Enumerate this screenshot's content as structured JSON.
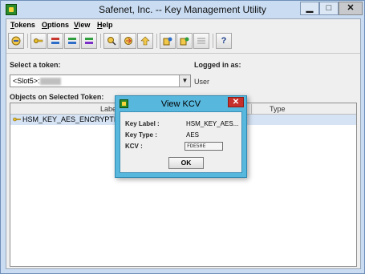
{
  "window": {
    "title": "Safenet, Inc. -- Key Management Utility"
  },
  "window_controls": {
    "minimize": "▁",
    "maximize": "□",
    "close": "✕"
  },
  "menu": [
    "Tokens",
    "Options",
    "View",
    "Help"
  ],
  "toolbar": {
    "buttons": [
      "login-icon",
      "key-icon",
      "key-pair-icon",
      "key-generate-icon",
      "key-list-icon",
      "search-key-icon",
      "wrap-key-icon",
      "upload-icon",
      "token-info-icon",
      "token-info-2-icon",
      "disabled-icon",
      "help-icon"
    ],
    "help_glyph": "?"
  },
  "select_token": {
    "label": "Select a token:",
    "value": "<Slot5>:",
    "arrow": "▼"
  },
  "logged_in": {
    "label": "Logged in as:",
    "value": "User"
  },
  "objects": {
    "label": "Objects on Selected Token:",
    "columns": [
      "Label",
      "Type"
    ],
    "rows": [
      {
        "label": "HSM_KEY_AES_ENCRYPTIO"
      }
    ]
  },
  "dialog": {
    "title": "View KCV",
    "close": "✕",
    "key_label_label": "Key Label :",
    "key_label_value": "HSM_KEY_AES...",
    "key_type_label": "Key Type :",
    "key_type_value": "AES",
    "kcv_label": "KCV :",
    "kcv_value": "FDE50E",
    "ok_label": "OK"
  },
  "colors": {
    "dialog_frame": "#58b7dd",
    "selected_row": "#d5e3f5",
    "close_red": "#c7302a"
  }
}
